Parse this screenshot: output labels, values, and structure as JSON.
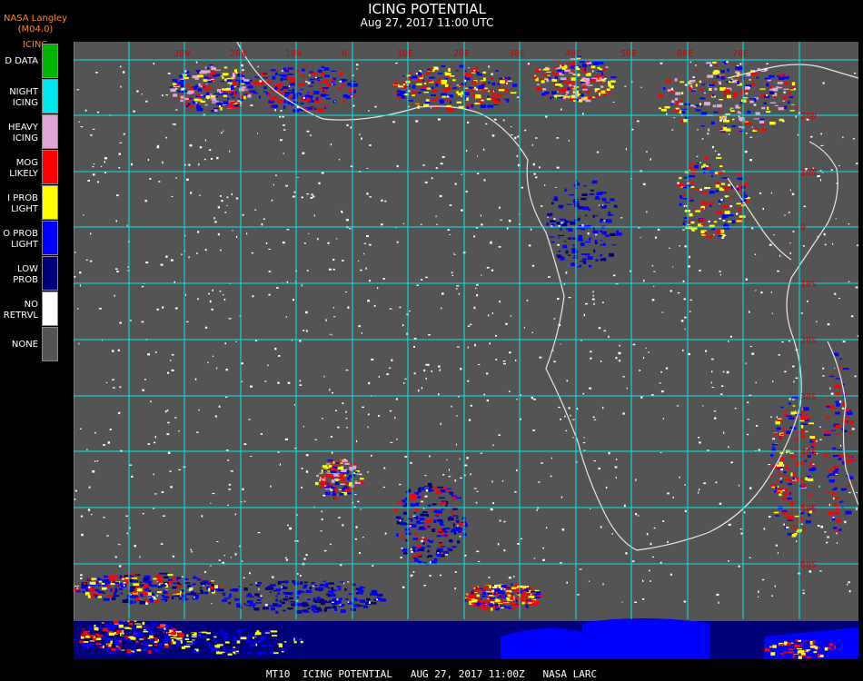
{
  "header": {
    "source": "NASA Langley (M04.0)",
    "legend_title": "ICING",
    "title": "ICING POTENTIAL",
    "subtitle": "Aug 27, 2017 11:00 UTC"
  },
  "legend": [
    {
      "line1": "D DATA",
      "line2": "",
      "color": "#00b400"
    },
    {
      "line1": "NIGHT",
      "line2": "ICING",
      "color": "#00e8ee"
    },
    {
      "line1": "HEAVY",
      "line2": "ICING",
      "color": "#e2a6d6"
    },
    {
      "line1": "MOG",
      "line2": "LIKELY",
      "color": "#ff0000"
    },
    {
      "line1": "I PROB",
      "line2": "LIGHT",
      "color": "#ffff00"
    },
    {
      "line1": "O PROB",
      "line2": "LIGHT",
      "color": "#0000ff"
    },
    {
      "line1": "LOW",
      "line2": "PROB",
      "color": "#00007a"
    },
    {
      "line1": "NO",
      "line2": "RETRVL",
      "color": "#ffffff"
    },
    {
      "line1": "NONE",
      "line2": "",
      "color": "#545454"
    }
  ],
  "map": {
    "background_color": "#545454",
    "grid_color": "#00e8ee",
    "coast_color": "#e8e8e8",
    "lon_labels_top": [
      "30W",
      "20W",
      "10W",
      "0",
      "10E",
      "20E",
      "30E",
      "40E",
      "50E",
      "60E",
      "70E"
    ],
    "lat_labels_right": [
      "20N",
      "10N",
      "0",
      "10S",
      "20S",
      "30S",
      "40S",
      "50S",
      "60S"
    ]
  },
  "footer": {
    "text": "MT10  ICING POTENTIAL   AUG 27, 2017 11:00Z   NASA LARC"
  }
}
